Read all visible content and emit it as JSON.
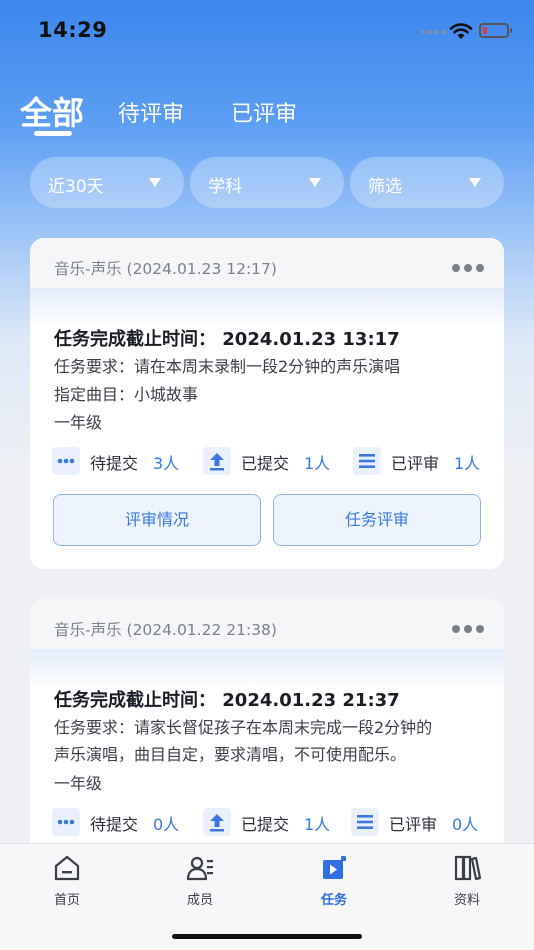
{
  "status_bar": {
    "time": "14:29"
  },
  "tabs": [
    {
      "label": "全部",
      "active": true
    },
    {
      "label": "待评审",
      "active": false
    },
    {
      "label": "已评审",
      "active": false
    }
  ],
  "filters": [
    {
      "label": "近30天"
    },
    {
      "label": "学科"
    },
    {
      "label": "筛选"
    }
  ],
  "cards": [
    {
      "subject_time": "音乐-声乐 (2024.01.23 12:17)",
      "deadline": "任务完成截止时间：  2024.01.23 13:17",
      "requirement_lines": [
        "任务要求：请在本周末录制一段2分钟的声乐演唱"
      ],
      "song": "指定曲目：小城故事",
      "grade": "一年级",
      "stats": [
        {
          "label": "待提交",
          "value": "3人",
          "icon": "more-dots-icon"
        },
        {
          "label": "已提交",
          "value": "1人",
          "icon": "upload-icon"
        },
        {
          "label": "已评审",
          "value": "1人",
          "icon": "list-icon"
        }
      ],
      "buttons": [
        "评审情况",
        "任务评审"
      ]
    },
    {
      "subject_time": "音乐-声乐 (2024.01.22 21:38)",
      "deadline": "任务完成截止时间：  2024.01.23 21:37",
      "requirement_lines": [
        "任务要求：请家长督促孩子在本周末完成一段2分钟的",
        "声乐演唱，曲目自定，要求清唱，不可使用配乐。"
      ],
      "grade": "一年级",
      "stats": [
        {
          "label": "待提交",
          "value": "0人",
          "icon": "more-dots-icon"
        },
        {
          "label": "已提交",
          "value": "1人",
          "icon": "upload-icon"
        },
        {
          "label": "已评审",
          "value": "0人",
          "icon": "list-icon"
        }
      ]
    }
  ],
  "bottom_nav": [
    {
      "label": "首页",
      "icon": "home-icon",
      "active": false
    },
    {
      "label": "成员",
      "icon": "members-icon",
      "active": false
    },
    {
      "label": "任务",
      "icon": "task-icon",
      "active": true
    },
    {
      "label": "资料",
      "icon": "books-icon",
      "active": false
    }
  ],
  "colors": {
    "accent": "#2f6fe4",
    "header_blue": "#3d86ee",
    "stat_value": "#3a78e0"
  }
}
